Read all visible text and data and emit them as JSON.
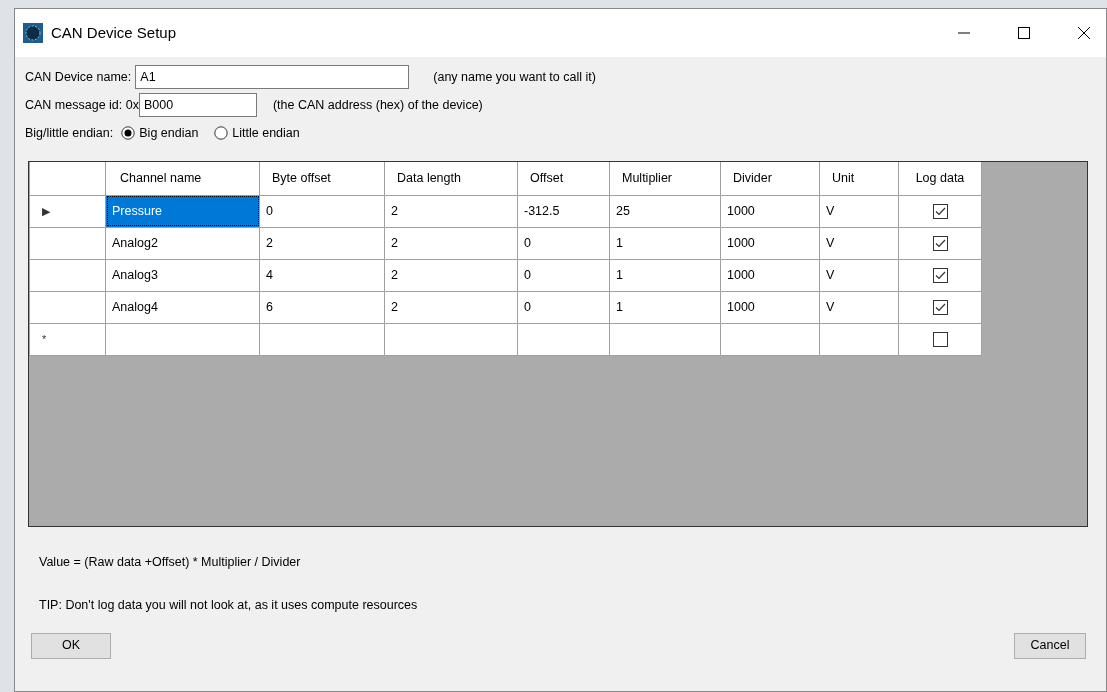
{
  "window": {
    "title": "CAN Device Setup"
  },
  "device_name": {
    "label": "CAN Device name:",
    "value": "A1",
    "hint": "(any name you want to call it)"
  },
  "message_id": {
    "label": "CAN message id: 0x",
    "value": "B000",
    "hint": "(the CAN address (hex) of the device)"
  },
  "endian": {
    "label": "Big/little endian:",
    "options": [
      {
        "label": "Big endian",
        "selected": true
      },
      {
        "label": "Little endian",
        "selected": false
      }
    ]
  },
  "grid": {
    "columns": [
      "Channel name",
      "Byte offset",
      "Data length",
      "Offset",
      "Multiplier",
      "Divider",
      "Unit",
      "Log data"
    ],
    "rows": [
      {
        "indicator": "▶",
        "selected": true,
        "cells": [
          "Pressure",
          "0",
          "2",
          "-312.5",
          "25",
          "1000",
          "V"
        ],
        "log_data": true
      },
      {
        "selected": false,
        "cells": [
          "Analog2",
          "2",
          "2",
          "0",
          "1",
          "1000",
          "V"
        ],
        "log_data": true
      },
      {
        "selected": false,
        "cells": [
          "Analog3",
          "4",
          "2",
          "0",
          "1",
          "1000",
          "V"
        ],
        "log_data": true
      },
      {
        "selected": false,
        "cells": [
          "Analog4",
          "6",
          "2",
          "0",
          "1",
          "1000",
          "V"
        ],
        "log_data": true
      },
      {
        "indicator": "*",
        "selected": false,
        "cells": [],
        "log_data": false
      }
    ]
  },
  "formula": "Value = (Raw data +Offset) * Multiplier / Divider",
  "tip": "TIP: Don't log data you will not look at, as it uses compute resources",
  "buttons": {
    "ok": "OK",
    "cancel": "Cancel"
  }
}
